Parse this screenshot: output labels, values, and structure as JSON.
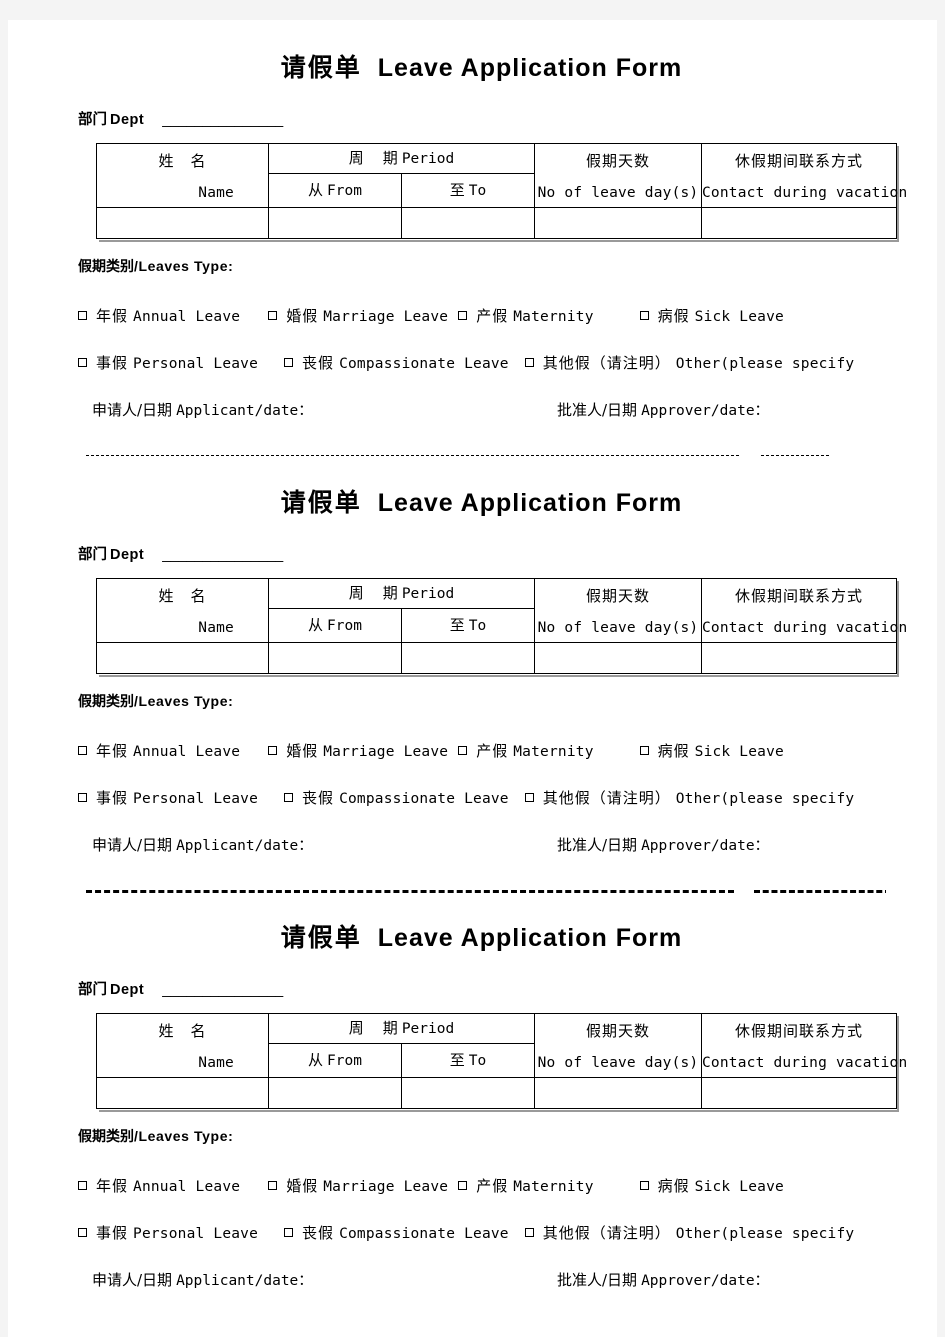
{
  "document": {
    "title_cn": "请假单",
    "title_en": "Leave Application Form",
    "dept_label_cn": "部门",
    "dept_label_en": "Dept",
    "dept_blank": "_______________",
    "table": {
      "headers": [
        {
          "cn": "姓　名",
          "en": "Name"
        },
        {
          "cn": "周　期",
          "en": "Period"
        },
        {
          "cn": "从",
          "en": "From"
        },
        {
          "cn": "至",
          "en": "To"
        },
        {
          "cn": "假期天数",
          "en": "No of leave day(s)"
        },
        {
          "cn": "休假期间联系方式",
          "en": "Contact during vacation"
        }
      ],
      "empty_row_cells": [
        "",
        "",
        "",
        "",
        ""
      ]
    },
    "leaves_type_label_cn": "假期类别",
    "leaves_type_label_en": "/Leaves Type:",
    "leave_options_row1": [
      {
        "cn": "年假",
        "en": "Annual Leave"
      },
      {
        "cn": "婚假",
        "en": "Marriage Leave"
      },
      {
        "cn": "产假",
        "en": "Maternity"
      },
      {
        "cn": "病假",
        "en": "Sick Leave"
      }
    ],
    "leave_options_row2": [
      {
        "cn": "事假",
        "en": "Personal Leave"
      },
      {
        "cn": "丧假",
        "en": "Compassionate Leave"
      },
      {
        "cn": "其他假（请注明）",
        "en": "Other(please specify"
      }
    ],
    "signature": {
      "applicant_cn": "申请人/日期",
      "applicant_en": "Applicant/date：",
      "approver_cn": "批准人/日期",
      "approver_en": "Approver/date："
    }
  },
  "colors": {
    "page_background": "#ffffff",
    "margin_background": "#f4f4f4",
    "text": "#000000",
    "table_border": "#000000",
    "table_shadow": "#9a9a9a"
  }
}
